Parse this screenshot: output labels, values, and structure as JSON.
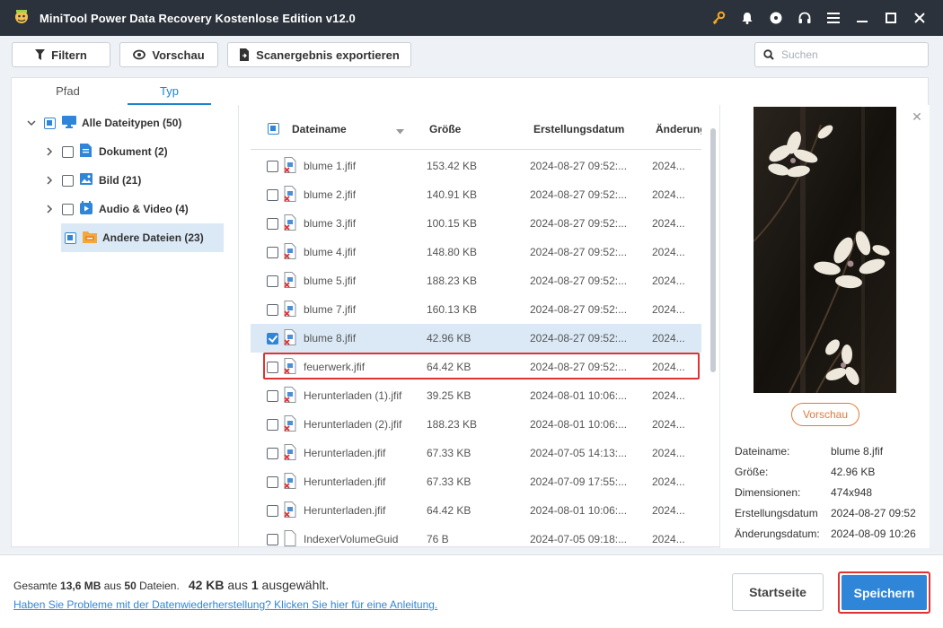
{
  "window": {
    "title": "MiniTool Power Data Recovery Kostenlose Edition v12.0",
    "icons": [
      "key-icon",
      "bell-icon",
      "disc-icon",
      "headset-icon",
      "menu-icon",
      "minimize-icon",
      "maximize-icon",
      "close-icon"
    ]
  },
  "toolbar": {
    "filter_label": "Filtern",
    "preview_label": "Vorschau",
    "export_label": "Scanergebnis exportieren",
    "search_placeholder": "Suchen"
  },
  "tabs": [
    {
      "label": "Pfad",
      "active": false
    },
    {
      "label": "Typ",
      "active": true
    }
  ],
  "tree": [
    {
      "label": "Alle Dateitypen (50)",
      "level": 0,
      "expanded": true,
      "check": "partial",
      "icon": "monitor-icon"
    },
    {
      "label": "Dokument (2)",
      "level": 1,
      "expanded": false,
      "check": "none",
      "icon": "document-icon"
    },
    {
      "label": "Bild (21)",
      "level": 1,
      "expanded": false,
      "check": "none",
      "icon": "image-icon"
    },
    {
      "label": "Audio & Video (4)",
      "level": 1,
      "expanded": false,
      "check": "none",
      "icon": "video-icon"
    },
    {
      "label": "Andere Dateien (23)",
      "level": 1,
      "expanded": null,
      "check": "partial",
      "icon": "folder-icon",
      "selected": true
    }
  ],
  "list": {
    "columns": [
      "Dateiname",
      "Größe",
      "Erstellungsdatum",
      "Änderungs"
    ],
    "rows": [
      {
        "name": "blume 1.jfif",
        "size": "153.42 KB",
        "created": "2024-08-27 09:52:...",
        "modified": "2024...",
        "checked": false,
        "deleted": true
      },
      {
        "name": "blume 2.jfif",
        "size": "140.91 KB",
        "created": "2024-08-27 09:52:...",
        "modified": "2024...",
        "checked": false,
        "deleted": true
      },
      {
        "name": "blume 3.jfif",
        "size": "100.15 KB",
        "created": "2024-08-27 09:52:...",
        "modified": "2024...",
        "checked": false,
        "deleted": true
      },
      {
        "name": "blume 4.jfif",
        "size": "148.80 KB",
        "created": "2024-08-27 09:52:...",
        "modified": "2024...",
        "checked": false,
        "deleted": true
      },
      {
        "name": "blume 5.jfif",
        "size": "188.23 KB",
        "created": "2024-08-27 09:52:...",
        "modified": "2024...",
        "checked": false,
        "deleted": true
      },
      {
        "name": "blume 7.jfif",
        "size": "160.13 KB",
        "created": "2024-08-27 09:52:...",
        "modified": "2024...",
        "checked": false,
        "deleted": true
      },
      {
        "name": "blume 8.jfif",
        "size": "42.96 KB",
        "created": "2024-08-27 09:52:...",
        "modified": "2024...",
        "checked": true,
        "deleted": true,
        "selected": true
      },
      {
        "name": "feuerwerk.jfif",
        "size": "64.42 KB",
        "created": "2024-08-27 09:52:...",
        "modified": "2024...",
        "checked": false,
        "deleted": true
      },
      {
        "name": "Herunterladen (1).jfif",
        "size": "39.25 KB",
        "created": "2024-08-01 10:06:...",
        "modified": "2024...",
        "checked": false,
        "deleted": true
      },
      {
        "name": "Herunterladen (2).jfif",
        "size": "188.23 KB",
        "created": "2024-08-01 10:06:...",
        "modified": "2024...",
        "checked": false,
        "deleted": true
      },
      {
        "name": "Herunterladen.jfif",
        "size": "67.33 KB",
        "created": "2024-07-05 14:13:...",
        "modified": "2024...",
        "checked": false,
        "deleted": true
      },
      {
        "name": "Herunterladen.jfif",
        "size": "67.33 KB",
        "created": "2024-07-09 17:55:...",
        "modified": "2024...",
        "checked": false,
        "deleted": true
      },
      {
        "name": "Herunterladen.jfif",
        "size": "64.42 KB",
        "created": "2024-08-01 10:06:...",
        "modified": "2024...",
        "checked": false,
        "deleted": true
      },
      {
        "name": "IndexerVolumeGuid",
        "size": "76 B",
        "created": "2024-07-05 09:18:...",
        "modified": "2024...",
        "checked": false,
        "deleted": false
      }
    ]
  },
  "preview": {
    "button_label": "Vorschau",
    "fields": [
      {
        "key": "Dateiname:",
        "value": "blume 8.jfif"
      },
      {
        "key": "Größe:",
        "value": "42.96 KB"
      },
      {
        "key": "Dimensionen:",
        "value": "474x948"
      },
      {
        "key": "Erstellungsdatum",
        "value": "2024-08-27 09:52"
      },
      {
        "key": "Änderungsdatum:",
        "value": "2024-08-09 10:26"
      }
    ]
  },
  "footer": {
    "total_prefix": "Gesamte ",
    "total_size": "13,6 MB",
    "total_mid": " aus ",
    "total_count": "50",
    "total_suffix": " Dateien.",
    "sel_size": "42 KB",
    "sel_mid": " aus ",
    "sel_count": "1",
    "sel_suffix": " ausgewählt.",
    "help_link": "Haben Sie Probleme mit der Datenwiederherstellung? Klicken Sie hier für eine Anleitung.",
    "home_label": "Startseite",
    "save_label": "Speichern"
  },
  "colors": {
    "titlebar": "#2b323b",
    "accent": "#2f86d9",
    "highlight_outline": "#e03232",
    "preview_button": "#e07b3a"
  }
}
